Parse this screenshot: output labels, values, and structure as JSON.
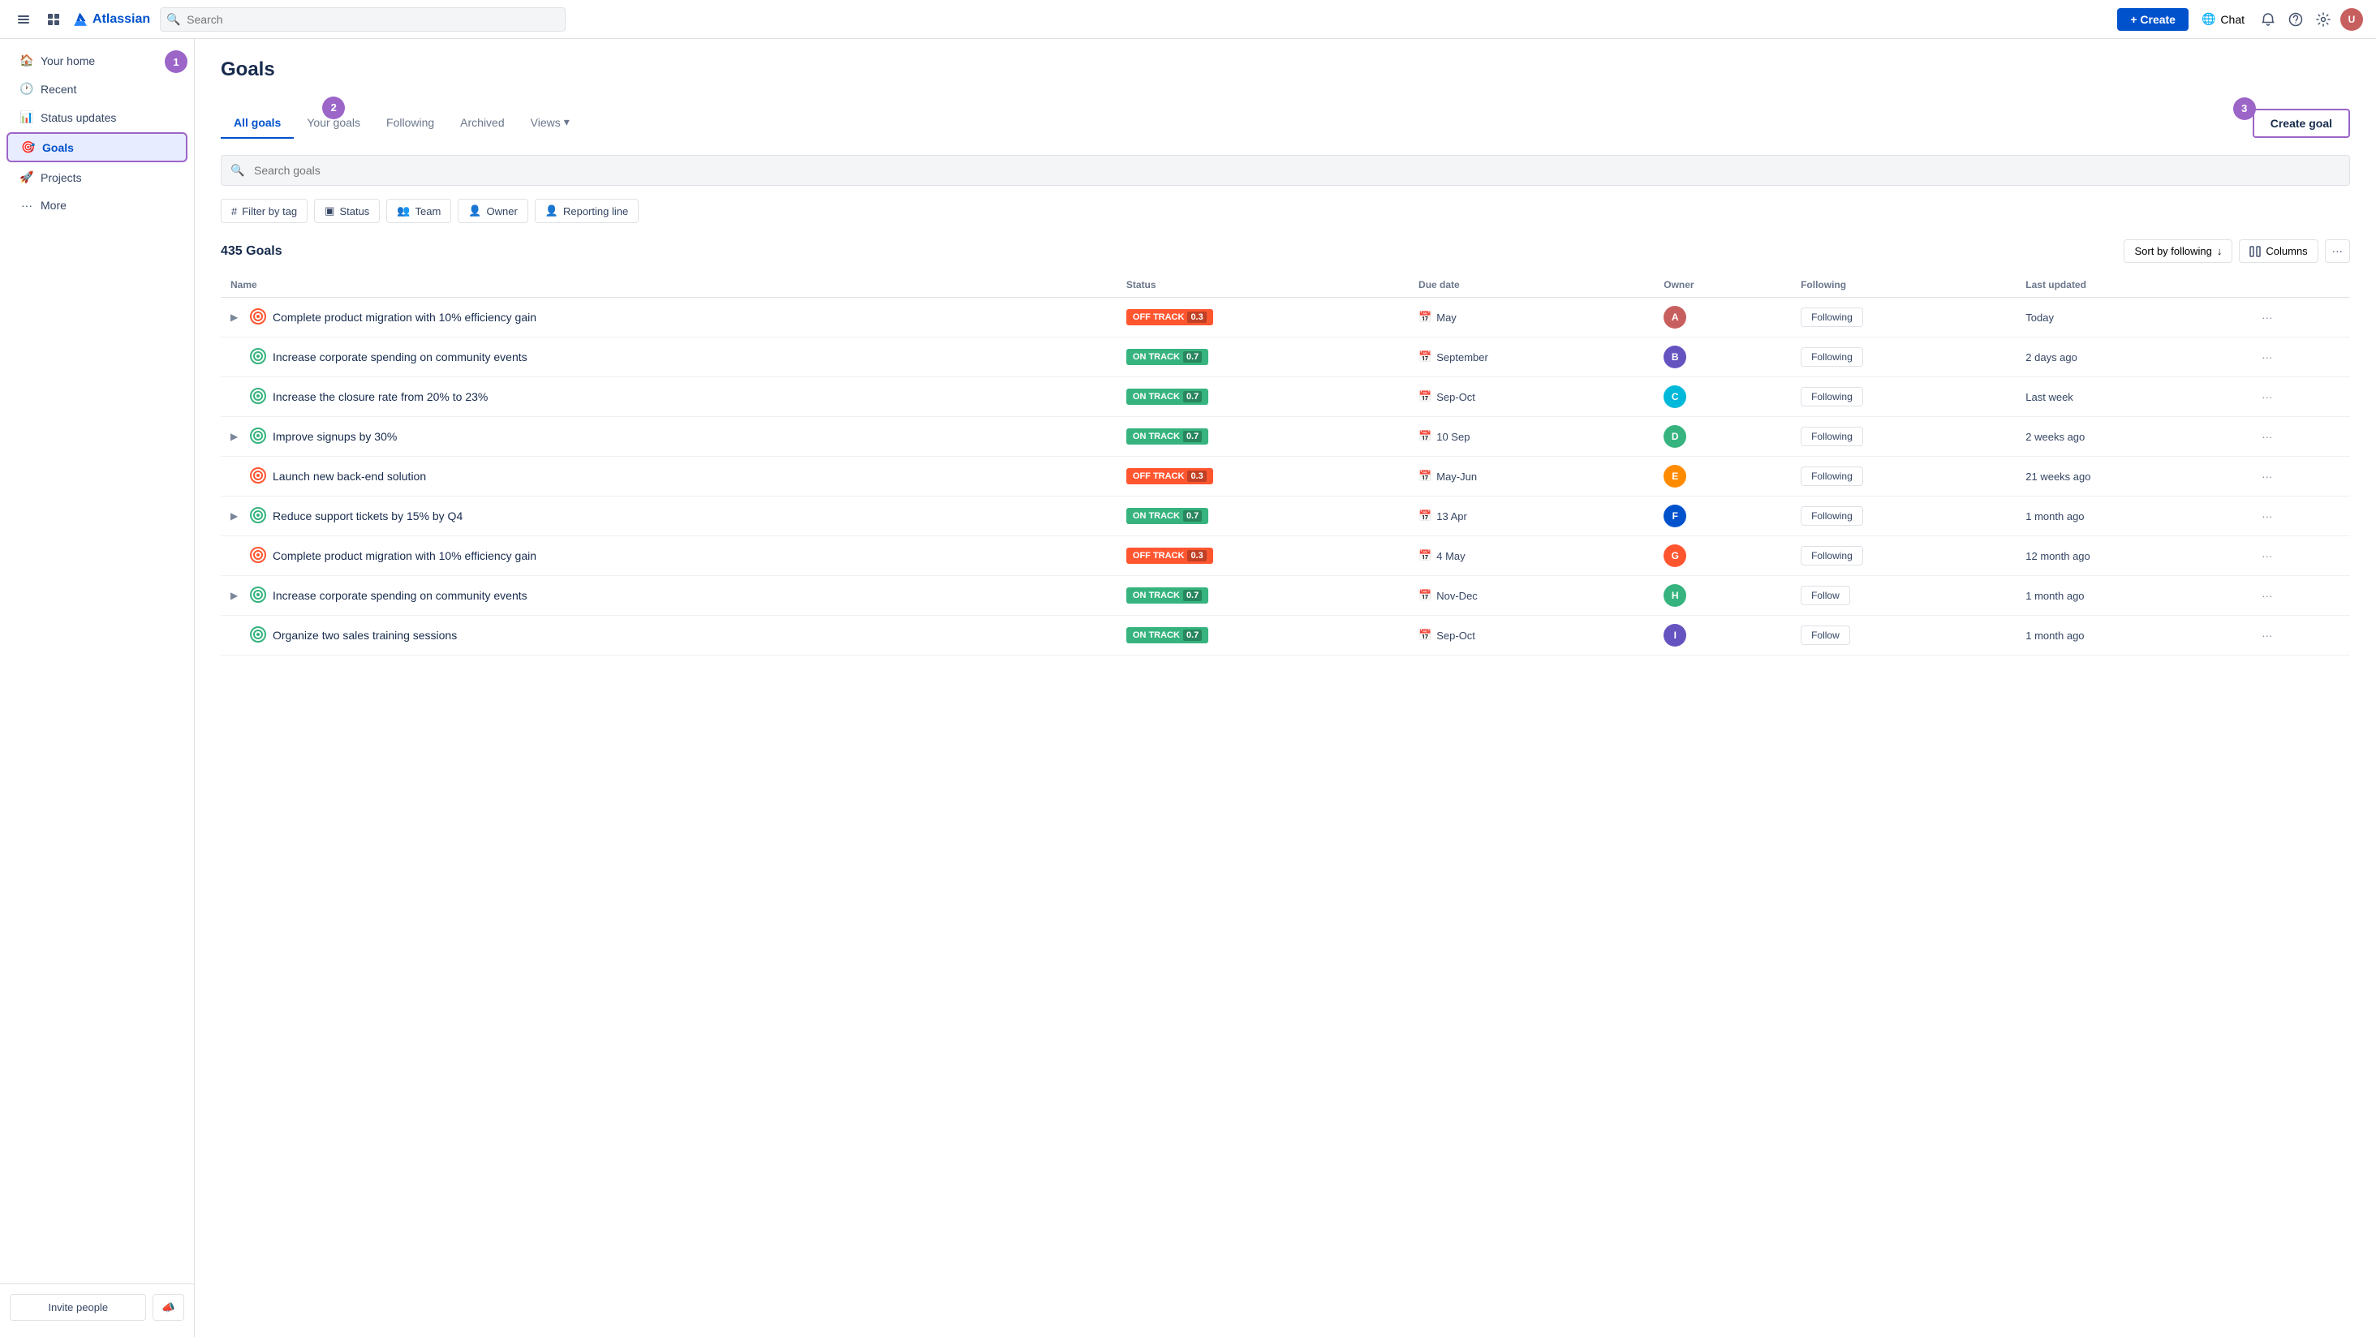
{
  "app": {
    "title": "Atlassian",
    "search_placeholder": "Search"
  },
  "topbar": {
    "create_label": "+ Create",
    "chat_label": "Chat",
    "search_placeholder": "Search"
  },
  "sidebar": {
    "items": [
      {
        "id": "your-home",
        "label": "Your home",
        "icon": "🏠"
      },
      {
        "id": "recent",
        "label": "Recent",
        "icon": "🕐"
      },
      {
        "id": "status-updates",
        "label": "Status updates",
        "icon": "📊"
      },
      {
        "id": "goals",
        "label": "Goals",
        "icon": "🎯",
        "active": true
      },
      {
        "id": "projects",
        "label": "Projects",
        "icon": "🚀"
      },
      {
        "id": "more",
        "label": "... More",
        "icon": ""
      }
    ],
    "invite_label": "Invite people"
  },
  "page": {
    "title": "Goals",
    "create_goal_label": "Create goal",
    "tabs": [
      {
        "id": "all-goals",
        "label": "All goals",
        "active": true
      },
      {
        "id": "your-goals",
        "label": "Your goals"
      },
      {
        "id": "following",
        "label": "Following"
      },
      {
        "id": "archived",
        "label": "Archived"
      },
      {
        "id": "views",
        "label": "Views ▾"
      }
    ],
    "search_goals_placeholder": "Search goals",
    "filters": [
      {
        "id": "filter-by-tag",
        "label": "Filter by tag",
        "icon": "#"
      },
      {
        "id": "status",
        "label": "Status",
        "icon": "▣"
      },
      {
        "id": "team",
        "label": "Team",
        "icon": "👥"
      },
      {
        "id": "owner",
        "label": "Owner",
        "icon": "👤"
      },
      {
        "id": "reporting-line",
        "label": "Reporting line",
        "icon": "👤"
      }
    ],
    "goals_count": "435 Goals",
    "sort_by": "Sort by following",
    "columns_label": "Columns",
    "table": {
      "headers": [
        "Name",
        "Status",
        "Due date",
        "Owner",
        "Following",
        "Last updated"
      ],
      "rows": [
        {
          "expand": true,
          "icon": "off-track-icon",
          "name": "Complete product migration with 10% efficiency gain",
          "status": "OFF TRACK",
          "status_num": "0.3",
          "status_type": "off",
          "due_date": "May",
          "owner_av": "dark",
          "following": "Following",
          "last_updated": "Today"
        },
        {
          "expand": false,
          "icon": "on-track-icon",
          "name": "Increase corporate spending on community events",
          "status": "ON TRACK",
          "status_num": "0.7",
          "status_type": "on",
          "due_date": "September",
          "owner_av": "light",
          "following": "Following",
          "last_updated": "2 days ago"
        },
        {
          "expand": false,
          "icon": "on-track-icon",
          "name": "Increase the closure rate from 20% to 23%",
          "status": "ON TRACK",
          "status_num": "0.7",
          "status_type": "on",
          "due_date": "Sep-Oct",
          "owner_av": "dark2",
          "following": "Following",
          "last_updated": "Last week"
        },
        {
          "expand": true,
          "icon": "on-track-icon",
          "name": "Improve signups by 30%",
          "status": "ON TRACK",
          "status_num": "0.7",
          "status_type": "on",
          "due_date": "10 Sep",
          "owner_av": "dark3",
          "following": "Following",
          "last_updated": "2 weeks ago"
        },
        {
          "expand": false,
          "icon": "off-track-icon2",
          "name": "Launch new back-end solution",
          "status": "OFF TRACK",
          "status_num": "0.3",
          "status_type": "off",
          "due_date": "May-Jun",
          "owner_av": "dark4",
          "following": "Following",
          "last_updated": "21 weeks ago"
        },
        {
          "expand": true,
          "icon": "on-track-icon",
          "name": "Reduce support tickets by 15% by Q4",
          "status": "ON TRACK",
          "status_num": "0.7",
          "status_type": "on",
          "due_date": "13 Apr",
          "owner_av": "dark5",
          "following": "Following",
          "last_updated": "1 month ago"
        },
        {
          "expand": false,
          "icon": "off-track-icon2",
          "name": "Complete product migration with 10% efficiency gain",
          "status": "OFF TRACK",
          "status_num": "0.3",
          "status_type": "off",
          "due_date": "4 May",
          "owner_av": "light2",
          "following": "Following",
          "last_updated": "12 month ago"
        },
        {
          "expand": true,
          "icon": "on-track-icon",
          "name": "Increase corporate spending on community events",
          "status": "ON TRACK",
          "status_num": "0.7",
          "status_type": "on",
          "due_date": "Nov-Dec",
          "owner_av": "dark6",
          "following": "Follow",
          "last_updated": "1 month ago"
        },
        {
          "expand": false,
          "icon": "on-track-icon",
          "name": "Organize two sales training sessions",
          "status": "ON TRACK",
          "status_num": "0.7",
          "status_type": "on",
          "due_date": "Sep-Oct",
          "owner_av": "dark7",
          "following": "Follow",
          "last_updated": "1 month ago"
        }
      ]
    }
  },
  "step_badges": {
    "one": "1",
    "two": "2",
    "three": "3"
  },
  "colors": {
    "on_track": "#36b37e",
    "off_track": "#ff5630",
    "active_tab": "#0052cc",
    "brand_blue": "#0052cc",
    "badge_purple": "#9c65c8"
  }
}
